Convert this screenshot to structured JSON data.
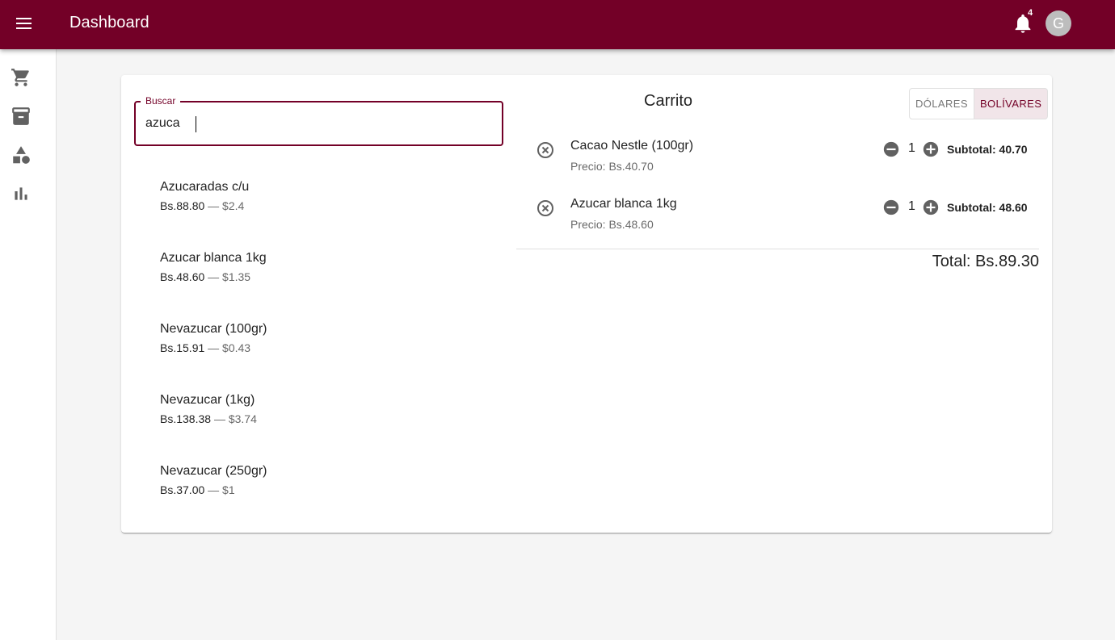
{
  "appbar": {
    "title": "Dashboard",
    "notification_count": "4",
    "avatar_initial": "G"
  },
  "sidebar": {
    "items": [
      {
        "name": "cart",
        "icon": "shopping-cart-icon"
      },
      {
        "name": "inventory",
        "icon": "archive-icon"
      },
      {
        "name": "categories",
        "icon": "shapes-icon"
      },
      {
        "name": "reports",
        "icon": "bar-chart-icon"
      }
    ]
  },
  "search": {
    "label": "Buscar",
    "value": "azuca"
  },
  "results": [
    {
      "name": "Azucaradas c/u",
      "bs": "Bs.88.80",
      "usd": " — $2.4"
    },
    {
      "name": "Azucar blanca 1kg",
      "bs": "Bs.48.60",
      "usd": " — $1.35"
    },
    {
      "name": "Nevazucar (100gr)",
      "bs": "Bs.15.91",
      "usd": " — $0.43"
    },
    {
      "name": "Nevazucar (1kg)",
      "bs": "Bs.138.38",
      "usd": " — $3.74"
    },
    {
      "name": "Nevazucar (250gr)",
      "bs": "Bs.37.00",
      "usd": " — $1"
    }
  ],
  "cart": {
    "title": "Carrito",
    "currency_options": [
      "DÓLARES",
      "BOLÍVARES"
    ],
    "selected_currency": "BOLÍVARES",
    "items": [
      {
        "name": "Cacao Nestle (100gr)",
        "price": "Precio: Bs.40.70",
        "qty": "1",
        "subtotal": "Subtotal: 40.70"
      },
      {
        "name": "Azucar blanca 1kg",
        "price": "Precio: Bs.48.60",
        "qty": "1",
        "subtotal": "Subtotal: 48.60"
      }
    ],
    "total": "Total: Bs.89.30"
  },
  "colors": {
    "primary": "#730027",
    "background": "#f5f5f5",
    "icon_grey": "#616161"
  }
}
